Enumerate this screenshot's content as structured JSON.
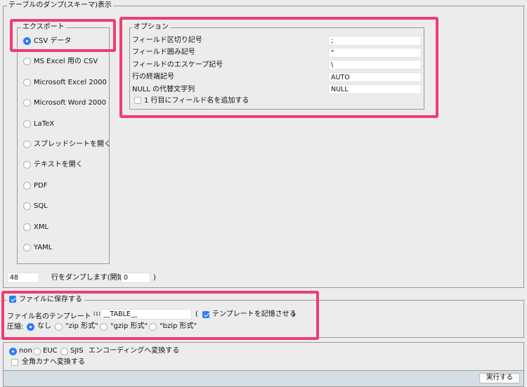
{
  "dump_title": "テーブルのダンプ(スキーマ)表示",
  "export": {
    "legend": "エクスポート",
    "selected": 0,
    "formats": [
      "CSV データ",
      "MS Excel 用の CSV",
      "Microsoft Excel 2000",
      "Microsoft Word 2000",
      "LaTeX",
      "スプレッドシートを開く",
      "テキストを開く",
      "PDF",
      "SQL",
      "XML",
      "YAML"
    ]
  },
  "options": {
    "legend": "オプション",
    "rows": [
      {
        "label": "フィールド区切り記号",
        "value": ";"
      },
      {
        "label": "フィールド囲み記号",
        "value": "\""
      },
      {
        "label": "フィールドのエスケープ記号",
        "value": "\\"
      },
      {
        "label": "行の終端記号",
        "value": "AUTO"
      },
      {
        "label": "NULL の代替文字列",
        "value": "NULL"
      }
    ],
    "add_field_names_label": "1 行目にフィールド名を追加する",
    "add_field_names_checked": false
  },
  "rows_dump": {
    "count": "48",
    "label": "行をダンプします(開始行:",
    "start": "0",
    "close": ")"
  },
  "save_file": {
    "legend": "ファイルに保存する",
    "checked": true,
    "template_label": "ファイル名のテンプレート",
    "template_sup": "(1)",
    "template_colon": ":",
    "template_value": "__TABLE__",
    "open_paren": "(",
    "remember_label": "テンプレートを記憶させる",
    "remember_checked": true,
    "close_paren": ")",
    "compression_label": "圧縮:",
    "compression_options": [
      "なし",
      "\"zip 形式\"",
      "\"gzip 形式\"",
      "\"bzip 形式\""
    ],
    "compression_selected": 0
  },
  "encoding": {
    "options": [
      "non",
      "EUC",
      "SJIS"
    ],
    "selected": 0,
    "label": "エンコーディングへ変換する",
    "kana_label": "全角カナへ変換する",
    "kana_checked": false
  },
  "execute_label": "実行する",
  "colors": {
    "highlight": "#ee3d72",
    "accent": "#2f7cf6",
    "footer": "#d5dde5"
  }
}
